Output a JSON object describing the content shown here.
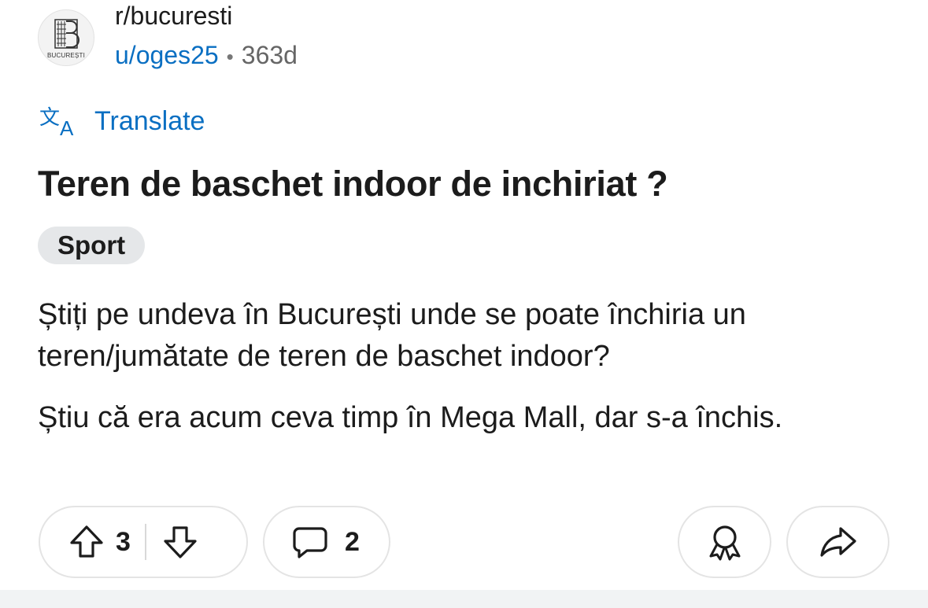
{
  "post": {
    "subreddit": "r/bucuresti",
    "avatar_text": "BUCUREȘTI",
    "author": "u/oges25",
    "separator": "•",
    "age": "363d",
    "translate_label": "Translate",
    "title": "Teren de baschet indoor de inchiriat ?",
    "flair": "Sport",
    "body": [
      "Știți pe undeva în București unde se poate închiria un teren/jumătate de teren de baschet indoor?",
      "Știu că era acum ceva timp în Mega Mall, dar s-a închis."
    ]
  },
  "actions": {
    "upvotes": "3",
    "comments": "2"
  },
  "icons": {
    "translate": "translate-icon",
    "upvote": "upvote-arrow-icon",
    "downvote": "downvote-arrow-icon",
    "comment": "comment-bubble-icon",
    "award": "award-ribbon-icon",
    "share": "share-arrow-icon"
  },
  "colors": {
    "link": "#0a6fc2",
    "text": "#1c1c1c",
    "muted": "#666666",
    "flair_bg": "#e5e7e9"
  }
}
